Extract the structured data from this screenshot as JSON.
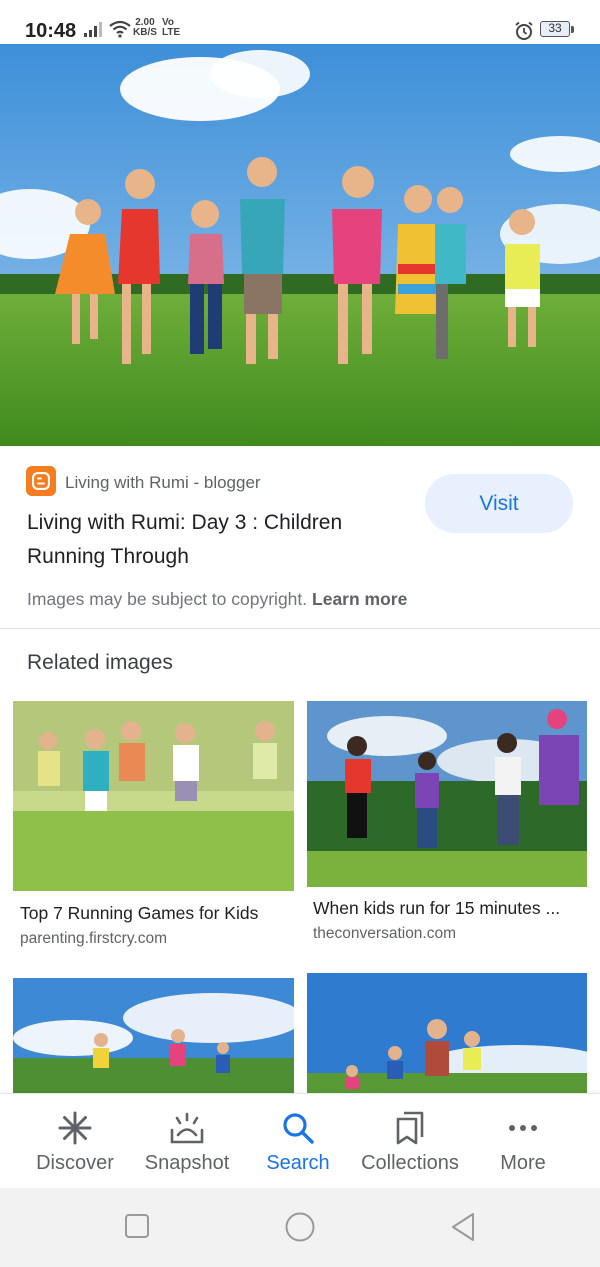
{
  "status_bar": {
    "time": "10:48",
    "net_speed_value": "2.00",
    "net_speed_unit": "KB/S",
    "volte_top": "Vo",
    "volte_bottom": "LTE",
    "battery": "33",
    "icons": [
      "signal-icon",
      "wifi-icon",
      "alarm-icon",
      "battery-icon"
    ]
  },
  "result": {
    "source_icon": "blogger-icon",
    "source_name": "Living with Rumi - blogger",
    "title": "Living with Rumi: Day 3 : Children Running Through",
    "visit_label": "Visit",
    "copyright_text": "Images may be subject to copyright.",
    "learn_more_label": "Learn more"
  },
  "related": {
    "heading": "Related images",
    "items": [
      {
        "caption": "Top 7 Running Games for Kids",
        "site": "parenting.firstcry.com"
      },
      {
        "caption": "When kids run for 15 minutes ...",
        "site": "theconversation.com"
      },
      {
        "caption": "",
        "site": ""
      },
      {
        "caption": "",
        "site": ""
      }
    ]
  },
  "bottom_nav": {
    "active": "Search",
    "items": [
      {
        "label": "Discover",
        "icon": "asterisk-icon"
      },
      {
        "label": "Snapshot",
        "icon": "snapshot-icon"
      },
      {
        "label": "Search",
        "icon": "search-icon"
      },
      {
        "label": "Collections",
        "icon": "collections-icon"
      },
      {
        "label": "More",
        "icon": "more-dots-icon"
      }
    ]
  },
  "system_nav": [
    "recents-square-icon",
    "home-circle-icon",
    "back-triangle-icon"
  ],
  "colors": {
    "accent": "#1a73e8",
    "visit_bg": "#e8f0fe",
    "blogger_orange": "#f57c1f",
    "text_primary": "#202124",
    "text_secondary": "#5f6368"
  }
}
